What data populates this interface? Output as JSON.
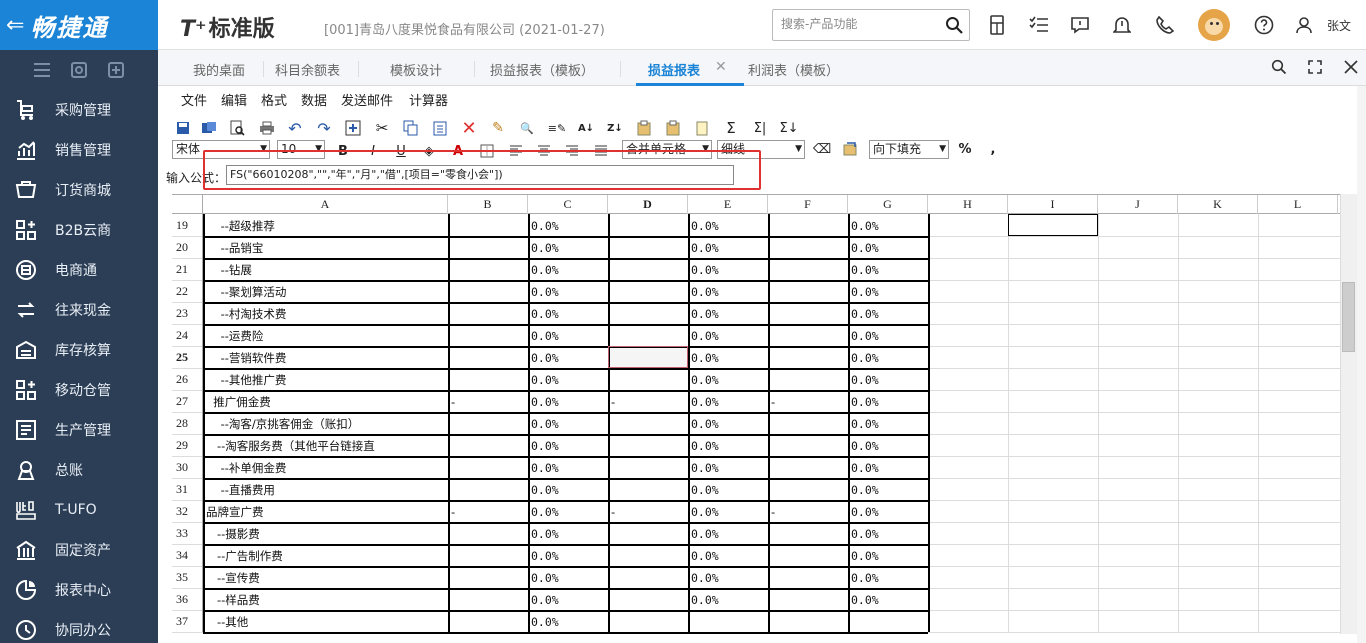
{
  "app": {
    "logo_text": "畅捷通",
    "brand_t": "T⁺",
    "brand_name": "标准版",
    "company": "[001]青岛八度果悦食品有限公司  (2021-01-27)",
    "user": "张文"
  },
  "search": {
    "placeholder": "搜索-产品功能"
  },
  "sidebar": {
    "tools": [
      "menu-icon",
      "search-doc-icon",
      "add-icon"
    ],
    "items": [
      {
        "label": "采购管理",
        "icon": "purchase-icon"
      },
      {
        "label": "销售管理",
        "icon": "sales-chart-icon"
      },
      {
        "label": "订货商城",
        "icon": "store-icon"
      },
      {
        "label": "B2B云商",
        "icon": "b2b-icon"
      },
      {
        "label": "电商通",
        "icon": "ecommerce-icon"
      },
      {
        "label": "往来现金",
        "icon": "exchange-icon"
      },
      {
        "label": "库存核算",
        "icon": "warehouse-icon"
      },
      {
        "label": "移动仓管",
        "icon": "mobile-warehouse-icon"
      },
      {
        "label": "生产管理",
        "icon": "production-icon"
      },
      {
        "label": "总账",
        "icon": "ledger-icon"
      },
      {
        "label": "T-UFO",
        "icon": "ufo-icon"
      },
      {
        "label": "固定资产",
        "icon": "assets-icon"
      },
      {
        "label": "报表中心",
        "icon": "report-icon"
      },
      {
        "label": "协同办公",
        "icon": "collab-icon"
      }
    ]
  },
  "tabs": [
    {
      "label": "我的桌面"
    },
    {
      "label": "科目余额表"
    },
    {
      "label": "模板设计"
    },
    {
      "label": "损益报表（模板）"
    },
    {
      "label": "损益报表",
      "active": true
    },
    {
      "label": "利润表（模板）"
    }
  ],
  "menu": [
    "文件",
    "编辑",
    "格式",
    "数据",
    "发送邮件",
    "计算器"
  ],
  "toolbar": {
    "font": "宋体",
    "size": "10",
    "merge": "合并单元格",
    "border": "细线",
    "fill": "向下填充",
    "bold": "B",
    "italic": "I",
    "underline": "U",
    "percent": "%",
    "comma": ","
  },
  "formula": {
    "label": "输入公式：",
    "value": "FS(\"66010208\",\"\",\"年\",\"月\",\"借\",[项目=\"零食小会\"])"
  },
  "grid": {
    "columns": [
      "A",
      "B",
      "C",
      "D",
      "E",
      "F",
      "G",
      "H",
      "I",
      "J",
      "K",
      "L"
    ],
    "current_row": "25",
    "rows": [
      {
        "n": "19",
        "a": "    --超级推荐",
        "b": "",
        "c": "0.0%",
        "d": "",
        "e": "0.0%",
        "f": "",
        "g": "0.0%"
      },
      {
        "n": "20",
        "a": "    --品销宝",
        "b": "",
        "c": "0.0%",
        "d": "",
        "e": "0.0%",
        "f": "",
        "g": "0.0%"
      },
      {
        "n": "21",
        "a": "    --钻展",
        "b": "",
        "c": "0.0%",
        "d": "",
        "e": "0.0%",
        "f": "",
        "g": "0.0%"
      },
      {
        "n": "22",
        "a": "    --聚划算活动",
        "b": "",
        "c": "0.0%",
        "d": "",
        "e": "0.0%",
        "f": "",
        "g": "0.0%"
      },
      {
        "n": "23",
        "a": "    --村淘技术费",
        "b": "",
        "c": "0.0%",
        "d": "",
        "e": "0.0%",
        "f": "",
        "g": "0.0%"
      },
      {
        "n": "24",
        "a": "    --运费险",
        "b": "",
        "c": "0.0%",
        "d": "",
        "e": "0.0%",
        "f": "",
        "g": "0.0%"
      },
      {
        "n": "25",
        "a": "    --营销软件费",
        "b": "",
        "c": "0.0%",
        "d": "",
        "e": "0.0%",
        "f": "",
        "g": "0.0%"
      },
      {
        "n": "26",
        "a": "    --其他推广费",
        "b": "",
        "c": "0.0%",
        "d": "",
        "e": "0.0%",
        "f": "",
        "g": "0.0%"
      },
      {
        "n": "27",
        "a": "  推广佣金费",
        "b": "-",
        "c": "0.0%",
        "d": "-",
        "e": "0.0%",
        "f": "-",
        "g": "0.0%"
      },
      {
        "n": "28",
        "a": "    --淘客/京挑客佣金（账扣）",
        "b": "",
        "c": "0.0%",
        "d": "",
        "e": "0.0%",
        "f": "",
        "g": "0.0%"
      },
      {
        "n": "29",
        "a": "   --淘客服务费（其他平台链接直",
        "b": "",
        "c": "0.0%",
        "d": "",
        "e": "0.0%",
        "f": "",
        "g": "0.0%"
      },
      {
        "n": "30",
        "a": "    --补单佣金费",
        "b": "",
        "c": "0.0%",
        "d": "",
        "e": "0.0%",
        "f": "",
        "g": "0.0%"
      },
      {
        "n": "31",
        "a": "    --直播费用",
        "b": "",
        "c": "0.0%",
        "d": "",
        "e": "0.0%",
        "f": "",
        "g": "0.0%"
      },
      {
        "n": "32",
        "a": "品牌宣广费",
        "b": "-",
        "c": "0.0%",
        "d": "-",
        "e": "0.0%",
        "f": "-",
        "g": "0.0%"
      },
      {
        "n": "33",
        "a": "   --摄影费",
        "b": "",
        "c": "0.0%",
        "d": "",
        "e": "0.0%",
        "f": "",
        "g": "0.0%"
      },
      {
        "n": "34",
        "a": "   --广告制作费",
        "b": "",
        "c": "0.0%",
        "d": "",
        "e": "0.0%",
        "f": "",
        "g": "0.0%"
      },
      {
        "n": "35",
        "a": "   --宣传费",
        "b": "",
        "c": "0.0%",
        "d": "",
        "e": "0.0%",
        "f": "",
        "g": "0.0%"
      },
      {
        "n": "36",
        "a": "   --样品费",
        "b": "",
        "c": "0.0%",
        "d": "",
        "e": "0.0%",
        "f": "",
        "g": "0.0%"
      },
      {
        "n": "37",
        "a": "   --其他",
        "b": "",
        "c": "0.0%",
        "d": "",
        "e": "",
        "f": "",
        "g": ""
      }
    ]
  }
}
